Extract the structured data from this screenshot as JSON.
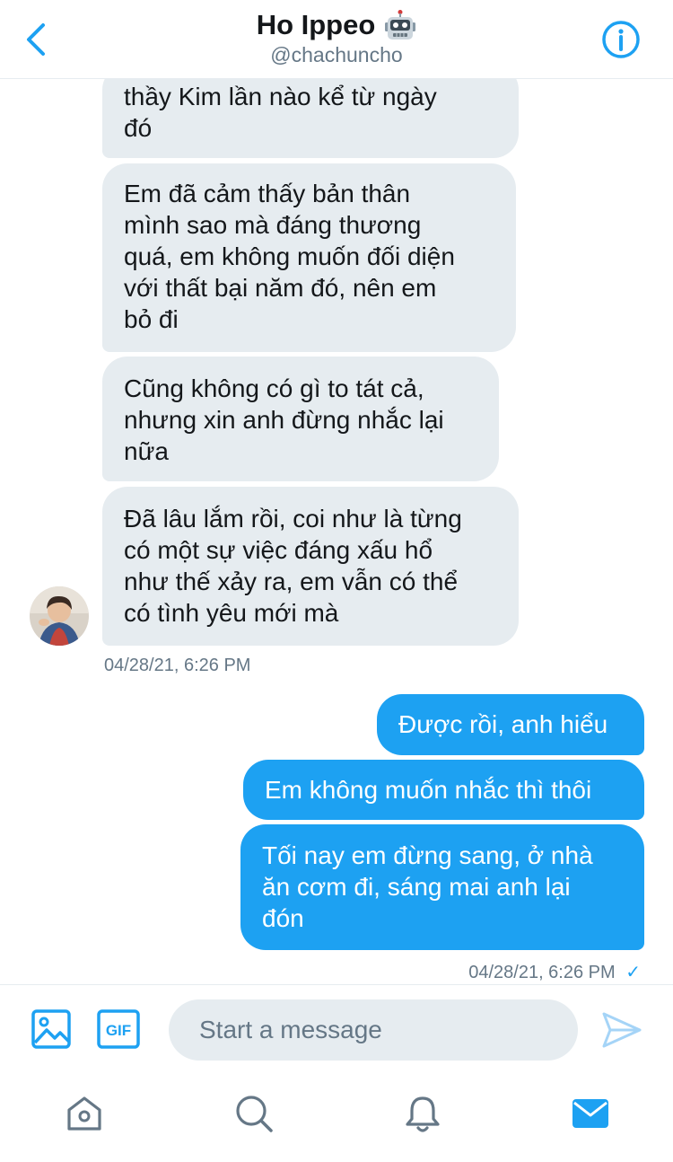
{
  "header": {
    "title": "Ho Ippeo",
    "title_emoji": "robot-face-icon",
    "handle": "@chachuncho"
  },
  "messages": {
    "incoming": [
      {
        "lines": [
          "thầy Kim lần nào kể từ ngày",
          "đó"
        ]
      },
      {
        "lines": [
          "Em đã cảm thấy bản thân",
          "mình sao mà đáng thương",
          "quá, em không muốn đối diện",
          "với thất bại năm đó, nên em",
          "bỏ đi"
        ]
      },
      {
        "lines": [
          "Cũng không có gì to tát cả,",
          "nhưng xin anh đừng nhắc lại",
          "nữa"
        ]
      },
      {
        "lines": [
          "Đã lâu lắm rồi, coi như là từng",
          "có một sự việc đáng xấu hổ",
          "như thế xảy ra, em vẫn có thể",
          "có tình yêu mới mà"
        ]
      }
    ],
    "incoming_timestamp": "04/28/21, 6:26 PM",
    "outgoing": [
      {
        "lines": [
          "Được rồi, anh hiểu"
        ]
      },
      {
        "lines": [
          "Em không muốn nhắc thì thôi"
        ]
      },
      {
        "lines": [
          "Tối nay em đừng sang, ở nhà",
          "ăn cơm đi, sáng mai anh lại",
          "đón"
        ]
      }
    ],
    "outgoing_timestamp": "04/28/21, 6:26 PM",
    "read_mark": "✓"
  },
  "composer": {
    "placeholder": "Start a message",
    "gif_label": "GIF"
  },
  "colors": {
    "accent": "#1da1f2",
    "incoming_bubble": "#e6ecf0",
    "secondary_text": "#657786"
  },
  "tabbar": {
    "items": [
      "home-icon",
      "search-icon",
      "notifications-icon",
      "messages-icon"
    ],
    "active": "messages-icon"
  }
}
